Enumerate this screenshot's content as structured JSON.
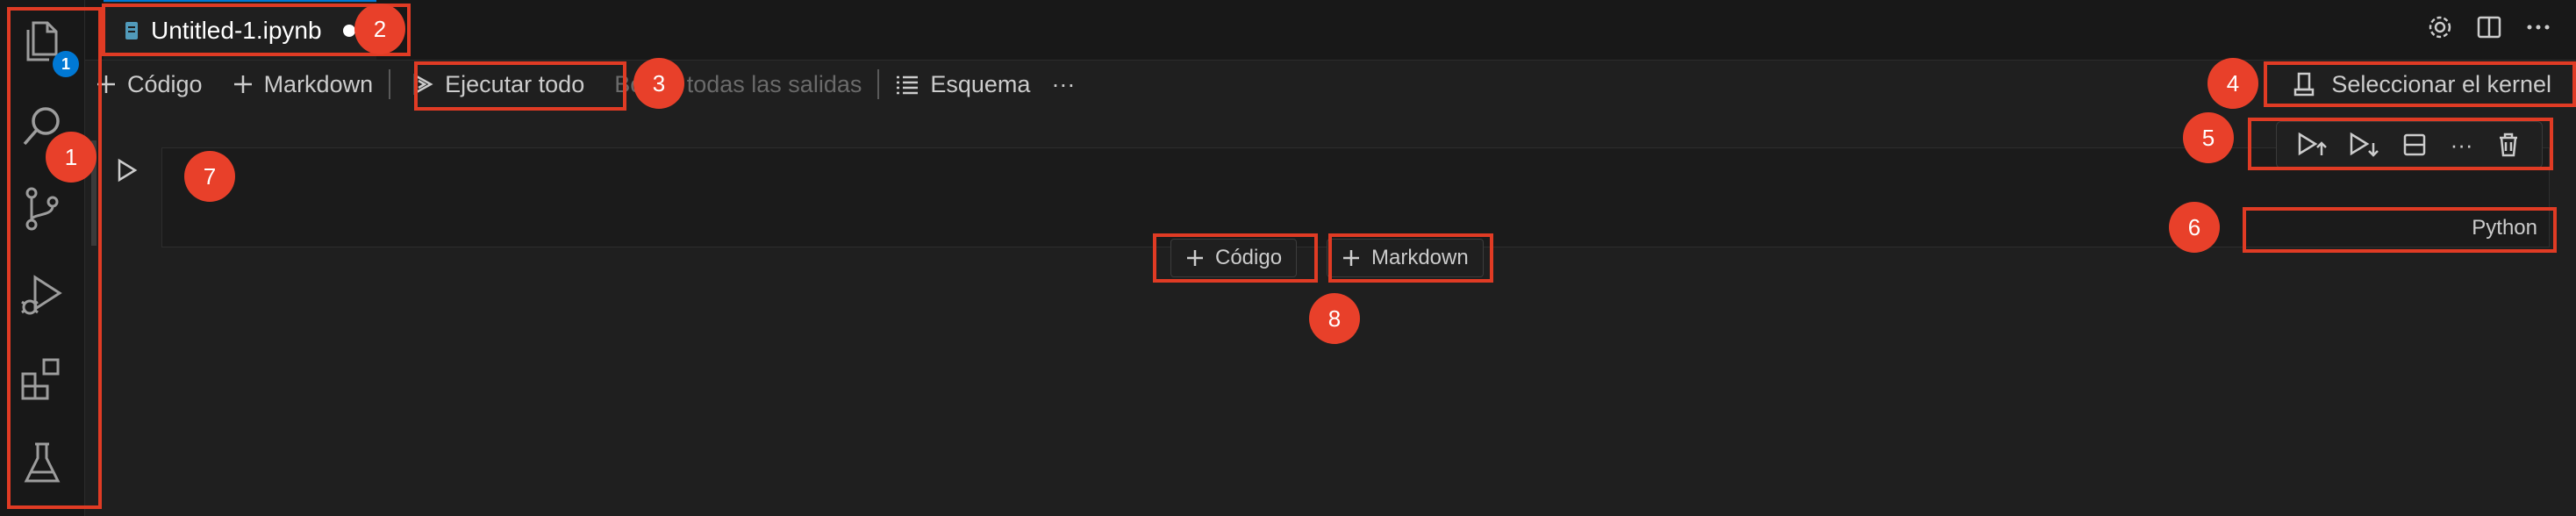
{
  "activity_bar": {
    "items": [
      {
        "name": "explorer",
        "badge": "1"
      },
      {
        "name": "search"
      },
      {
        "name": "source-control"
      },
      {
        "name": "run-and-debug"
      },
      {
        "name": "extensions"
      },
      {
        "name": "testing"
      }
    ]
  },
  "tab": {
    "title": "Untitled-1.ipynb"
  },
  "toolbar": {
    "code_label": "Código",
    "markdown_label": "Markdown",
    "run_all_label": "Ejecutar todo",
    "clear_outputs_label": "Borrar todas las salidas",
    "outline_label": "Esquema",
    "more_label": "···"
  },
  "kernel": {
    "label": "Seleccionar el kernel"
  },
  "cell": {
    "language": "Python",
    "more_label": "···"
  },
  "add_cell": {
    "code_label": "Código",
    "markdown_label": "Markdown"
  },
  "annotations": [
    "1",
    "2",
    "3",
    "4",
    "5",
    "6",
    "7",
    "8"
  ],
  "colors": {
    "accent": "#0078d4",
    "annotation": "#e03b24",
    "background": "#1f1f1f"
  }
}
